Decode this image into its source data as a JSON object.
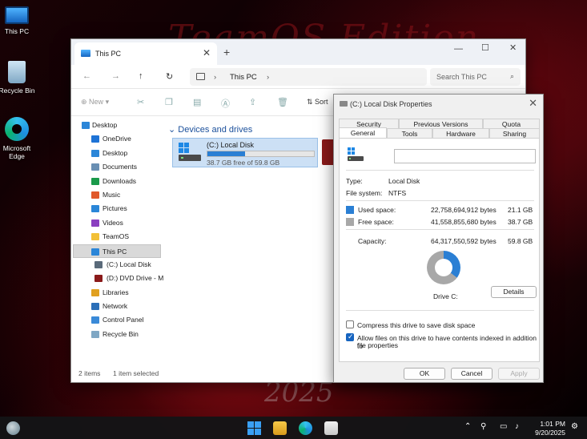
{
  "desktop": {
    "wallpaper_title": "TeamOS Edition",
    "wallpaper_year": "2025",
    "icons": [
      {
        "label": "This PC",
        "icon": "monitor-icon"
      },
      {
        "label": "Recycle Bin",
        "icon": "recycle-bin-icon"
      },
      {
        "label": "Microsoft Edge",
        "icon": "edge-icon"
      }
    ]
  },
  "explorer": {
    "tab_title": "This PC",
    "window_controls": {
      "minimize": "—",
      "maximize": "☐",
      "close": "✕"
    },
    "nav": {
      "back": "←",
      "forward": "→",
      "up": "↑",
      "refresh": "↻"
    },
    "address": {
      "breadcrumb": "This PC",
      "sep": "›"
    },
    "search_placeholder": "Search This PC",
    "toolbar": {
      "new_label": "New",
      "sort_label": "Sort"
    },
    "sidebar": [
      {
        "label": "Desktop",
        "icon": "desktop-icon",
        "color": "#2b86d8",
        "level": 1
      },
      {
        "label": "OneDrive",
        "icon": "cloud-icon",
        "color": "#1e73d6",
        "level": 2
      },
      {
        "label": "Desktop",
        "icon": "desktop-icon",
        "color": "#2b86d8",
        "level": 2
      },
      {
        "label": "Documents",
        "icon": "documents-icon",
        "color": "#6a8fb3",
        "level": 2
      },
      {
        "label": "Downloads",
        "icon": "download-icon",
        "color": "#1a9a4a",
        "level": 2
      },
      {
        "label": "Music",
        "icon": "music-icon",
        "color": "#e0582a",
        "level": 2
      },
      {
        "label": "Pictures",
        "icon": "pictures-icon",
        "color": "#2a86d8",
        "level": 2
      },
      {
        "label": "Videos",
        "icon": "videos-icon",
        "color": "#8a3fc0",
        "level": 2
      },
      {
        "label": "TeamOS",
        "icon": "folder-icon",
        "color": "#f2c037",
        "level": 2
      },
      {
        "label": "This PC",
        "icon": "monitor-icon",
        "color": "#2b86d8",
        "level": 2,
        "selected": true
      },
      {
        "label": "(C:) Local Disk",
        "icon": "drive-icon",
        "color": "#5a6a7a",
        "level": 3
      },
      {
        "label": "(D:) DVD Drive - M",
        "icon": "dvd-icon",
        "color": "#8a1a1a",
        "level": 3
      },
      {
        "label": "Libraries",
        "icon": "libraries-icon",
        "color": "#e0a020",
        "level": 2
      },
      {
        "label": "Network",
        "icon": "network-icon",
        "color": "#2b6fb8",
        "level": 2
      },
      {
        "label": "Control Panel",
        "icon": "control-panel-icon",
        "color": "#3a8ad8",
        "level": 2
      },
      {
        "label": "Recycle Bin",
        "icon": "recycle-bin-icon",
        "color": "#7fa7c4",
        "level": 2
      }
    ],
    "group_header": "Devices and drives",
    "drive": {
      "name": "(C:) Local Disk",
      "free_text": "38.7 GB free of 59.8 GB",
      "used_fraction": 0.353
    },
    "status": {
      "items": "2 items",
      "selected": "1 item selected"
    }
  },
  "properties": {
    "title": "(C:) Local Disk Properties",
    "tabs_row1": [
      "Security",
      "Previous Versions",
      "Quota"
    ],
    "tabs_row2": [
      "General",
      "Tools",
      "Hardware",
      "Sharing"
    ],
    "active_tab": "General",
    "type_label": "Type:",
    "type_value": "Local Disk",
    "fs_label": "File system:",
    "fs_value": "NTFS",
    "used": {
      "label": "Used space:",
      "bytes": "22,758,694,912 bytes",
      "size": "21.1 GB",
      "color": "#2a7fd4"
    },
    "free": {
      "label": "Free space:",
      "bytes": "41,558,855,680 bytes",
      "size": "38.7 GB",
      "color": "#a8a8a8"
    },
    "capacity": {
      "label": "Capacity:",
      "bytes": "64,317,550,592 bytes",
      "size": "59.8 GB"
    },
    "used_fraction": 0.353,
    "drive_label": "Drive C:",
    "details_button": "Details",
    "compress_label": "Compress this drive to save disk space",
    "compress_checked": false,
    "index_label_1": "Allow files on this drive to have contents indexed in addition to",
    "index_label_2": "file properties",
    "index_checked": true,
    "ok": "OK",
    "cancel": "Cancel",
    "apply": "Apply"
  },
  "taskbar": {
    "time": "1:01 PM",
    "date": "9/20/2025",
    "icons": [
      "weather-icon",
      "start-icon",
      "file-explorer-icon",
      "edge-icon",
      "store-icon"
    ]
  }
}
